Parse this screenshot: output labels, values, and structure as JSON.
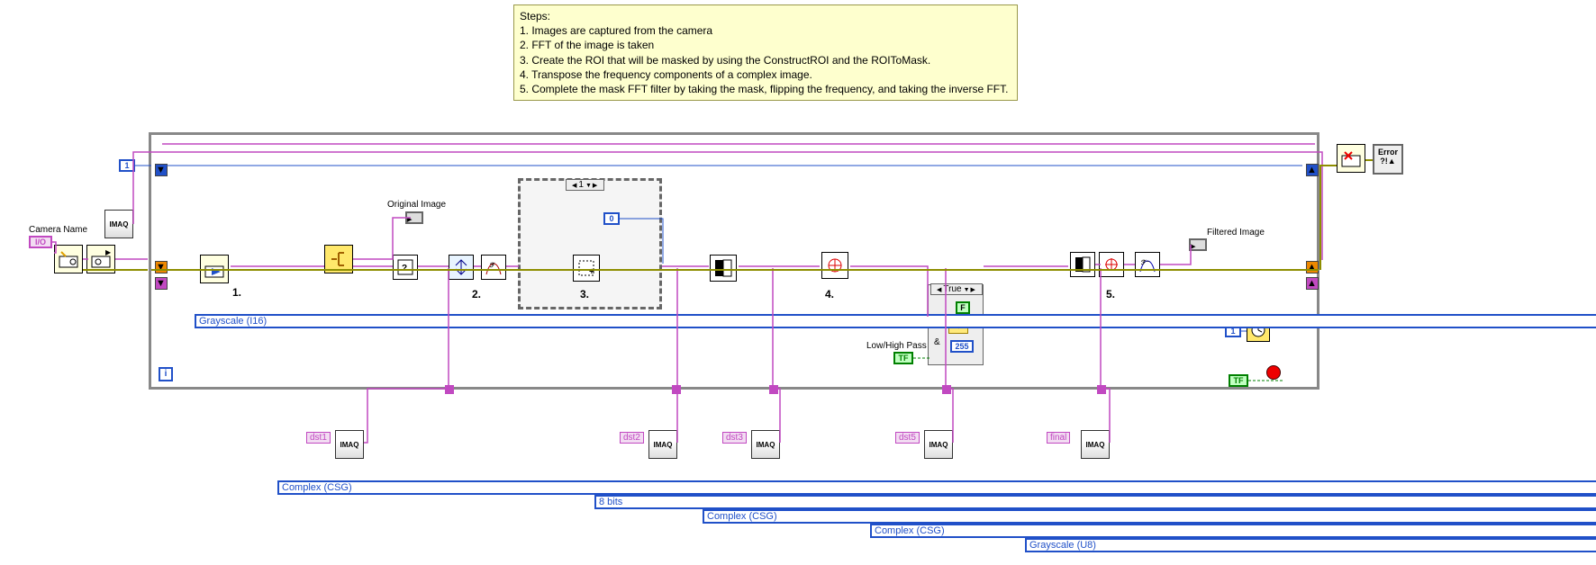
{
  "comment": {
    "title": "Steps:",
    "lines": [
      "1.  Images are captured from the camera",
      "2.  FFT of the image is taken",
      "3.  Create the ROI that will be masked by using the ConstructROI and the ROIToMask.",
      "4.  Transpose the frequency components of a complex image.",
      "5.  Complete the mask FFT filter by taking the mask, flipping the frequency, and taking the inverse FFT."
    ]
  },
  "terminals": {
    "cameraName": "Camera Name",
    "originalImage": "Original Image",
    "filteredImage": "Filtered Image",
    "lowHighPass": "Low/High Pass"
  },
  "rings": {
    "grayscaleI16": "Grayscale (I16)",
    "complexCsg1": "Complex (CSG)",
    "complexCsg2": "Complex (CSG)",
    "complexCsg3": "Complex (CSG)",
    "eightBits": "8 bits",
    "grayscaleU8": "Grayscale (U8)"
  },
  "dst": {
    "d1": "dst1",
    "d2": "dst2",
    "d3": "dst3",
    "d5": "dst5",
    "final": "final"
  },
  "consts": {
    "one_a": "1",
    "zero": "0",
    "one_b": "1",
    "case": "True",
    "maskVal": "255",
    "notF": "F"
  },
  "steps": {
    "s1": "1.",
    "s2": "2.",
    "s3": "3.",
    "s4": "4.",
    "s5": "5."
  },
  "selector": "1"
}
